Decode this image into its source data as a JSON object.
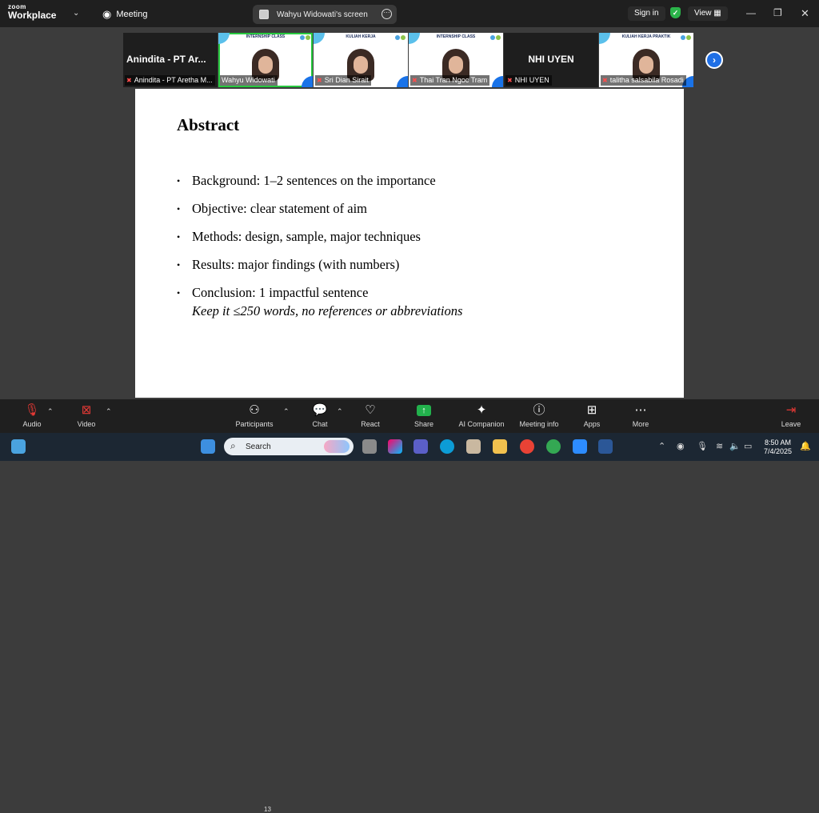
{
  "app": {
    "logo_top": "zoom",
    "logo_bottom": "Workplace",
    "meeting_label": "Meeting",
    "share_tab_title": "Wahyu Widowati's screen",
    "sign_in": "Sign in",
    "view": "View"
  },
  "gallery": {
    "tiles": [
      {
        "big_name": "Anindita - PT Ar...",
        "caption": "Anindita - PT Aretha M..."
      },
      {
        "banner": "INTERNSHIP CLASS",
        "caption": "Wahyu Widowati"
      },
      {
        "banner": "KULIAH KERJA",
        "caption": "Sri Dian Sirait"
      },
      {
        "banner": "INTERNSHIP CLASS",
        "caption": "Thai Tran Ngoc Tram"
      },
      {
        "big_name": "NHI UYEN",
        "caption": "NHI UYEN"
      },
      {
        "banner": "KULIAH KERJA PRAKTIK",
        "caption": "talitha salsabila Rosadi"
      }
    ]
  },
  "slide": {
    "title": "Abstract",
    "bullets": [
      "Background: 1–2 sentences on the importance",
      "Objective: clear statement of aim",
      "Methods: design, sample, major techniques",
      "Results: major findings (with numbers)",
      "Conclusion: 1 impactful sentence"
    ],
    "note": "Keep it ≤250 words, no references or abbreviations"
  },
  "toolbar": {
    "audio": "Audio",
    "video": "Video",
    "participants": "Participants",
    "participants_count": "13",
    "chat": "Chat",
    "react": "React",
    "share": "Share",
    "ai_companion": "AI Companion",
    "meeting_info": "Meeting info",
    "apps": "Apps",
    "more": "More",
    "leave": "Leave"
  },
  "taskbar": {
    "search_placeholder": "Search",
    "time": "8:50 AM",
    "date": "7/4/2025"
  }
}
